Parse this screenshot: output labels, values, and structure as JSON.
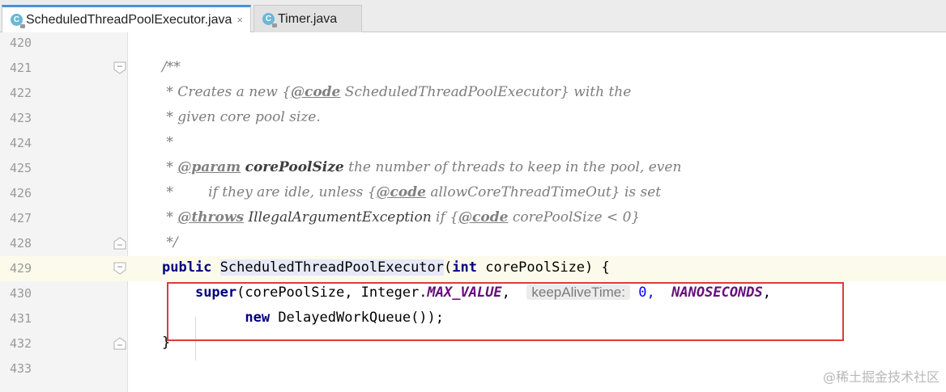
{
  "tabs": [
    {
      "label": "ScheduledThreadPoolExecutor.java",
      "icon": "java-class-icon",
      "active": true,
      "close": "×"
    },
    {
      "label": "Timer.java",
      "icon": "java-class-icon",
      "active": false
    }
  ],
  "icon_letter": "C",
  "lines": [
    {
      "num": "420"
    },
    {
      "num": "421",
      "t": [
        "/**"
      ]
    },
    {
      "num": "422",
      "t": [
        " * Creates a new {",
        "@code",
        " ScheduledThreadPoolExecutor} with the"
      ]
    },
    {
      "num": "423",
      "t": [
        " * given core pool size."
      ]
    },
    {
      "num": "424",
      "t": [
        " *"
      ]
    },
    {
      "num": "425",
      "t": [
        " * ",
        "@param",
        " ",
        "corePoolSize",
        " the number of threads to keep in the pool, even"
      ]
    },
    {
      "num": "426",
      "t": [
        " *        if they are idle, unless {",
        "@code",
        " allowCoreThreadTimeOut} is set"
      ]
    },
    {
      "num": "427",
      "t": [
        " * ",
        "@throws",
        " ",
        "IllegalArgumentException",
        " if {",
        "@code",
        " corePoolSize < 0}"
      ]
    },
    {
      "num": "428",
      "t": [
        " */"
      ]
    },
    {
      "num": "429",
      "t": [
        "public",
        " ",
        "ScheduledThreadPoolExecutor",
        "(",
        "int",
        " corePoolSize) {"
      ]
    },
    {
      "num": "430",
      "t": [
        "    ",
        "super",
        "(corePoolSize, Integer.",
        "MAX_VALUE",
        ",  ",
        "keepAliveTime:",
        " 0,  ",
        "NANOSECONDS",
        ","
      ]
    },
    {
      "num": "431",
      "t": [
        "          ",
        "new",
        " DelayedWorkQueue());"
      ]
    },
    {
      "num": "432",
      "t": [
        "}"
      ]
    },
    {
      "num": "433"
    }
  ],
  "watermark": "@稀土掘金技术社区"
}
